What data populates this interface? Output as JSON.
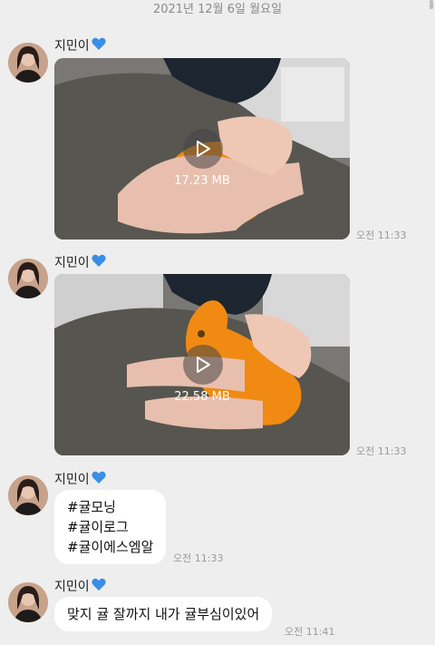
{
  "date_divider": "2021년 12월 6일 월요일",
  "sender_name": "지민이",
  "messages": [
    {
      "type": "video",
      "size": "17.23 MB",
      "time": "오전 11:33"
    },
    {
      "type": "video",
      "size": "22.58 MB",
      "time": "오전 11:33"
    },
    {
      "type": "text",
      "lines": [
        "#귤모닝",
        "#귤이로그",
        "#귤이에스엠알"
      ],
      "time": "오전 11:33"
    },
    {
      "type": "text",
      "lines": [
        "맞지 귤 잘까지 내가 귤부심이있어"
      ],
      "time": "오전 11:41"
    }
  ],
  "colors": {
    "background": "#eeeeee",
    "bubble": "#ffffff",
    "heart": "#3a8ee6",
    "orange": "#f08a12"
  },
  "icons": {
    "heart": "blue-heart-icon",
    "play": "play-icon"
  }
}
